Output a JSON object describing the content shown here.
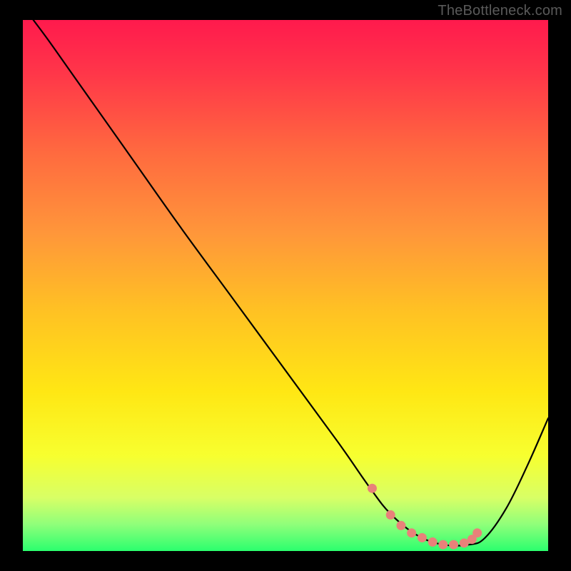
{
  "watermark": "TheBottleneck.com",
  "chart_data": {
    "type": "line",
    "title": "",
    "xlabel": "",
    "ylabel": "",
    "xlim": [
      0,
      100
    ],
    "ylim": [
      0,
      100
    ],
    "grid": false,
    "legend": false,
    "series": [
      {
        "name": "curve",
        "x": [
          2,
          5,
          10,
          20,
          30,
          40,
          50,
          60,
          66,
          70,
          75,
          80,
          85,
          88,
          92,
          96,
          100
        ],
        "values": [
          100,
          96,
          89,
          75,
          61,
          47.5,
          34,
          20.5,
          12,
          7,
          3,
          1.2,
          1.2,
          2.5,
          8,
          16,
          25
        ]
      }
    ],
    "markers": {
      "name": "marker-dots",
      "color": "#e8817a",
      "x": [
        66.5,
        70,
        72,
        74,
        76,
        78,
        80,
        82,
        84,
        85.5,
        86.5
      ],
      "values": [
        11.8,
        6.8,
        4.8,
        3.4,
        2.5,
        1.7,
        1.2,
        1.2,
        1.5,
        2.2,
        3.4
      ]
    },
    "gradient": {
      "stops": [
        {
          "offset": 0.0,
          "color": "#ff1a4d"
        },
        {
          "offset": 0.1,
          "color": "#ff3649"
        },
        {
          "offset": 0.25,
          "color": "#ff6a3f"
        },
        {
          "offset": 0.4,
          "color": "#ff963a"
        },
        {
          "offset": 0.55,
          "color": "#ffc223"
        },
        {
          "offset": 0.7,
          "color": "#ffe714"
        },
        {
          "offset": 0.82,
          "color": "#f7ff2f"
        },
        {
          "offset": 0.9,
          "color": "#d8ff66"
        },
        {
          "offset": 0.95,
          "color": "#8fff7a"
        },
        {
          "offset": 1.0,
          "color": "#2bff6e"
        }
      ]
    }
  }
}
